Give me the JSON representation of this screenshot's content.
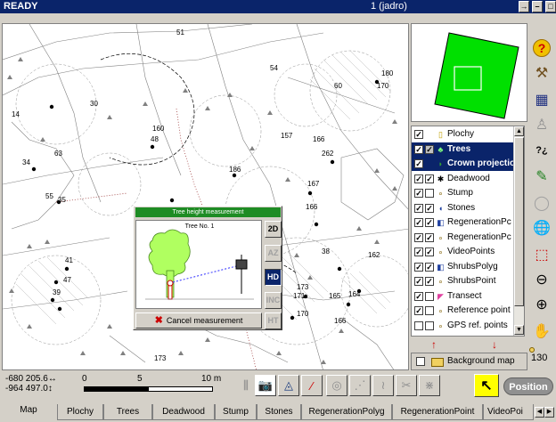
{
  "titlebar": {
    "status": "READY",
    "mode": "1 (jadro)"
  },
  "dialog": {
    "header": "Tree height measurement",
    "tree_label": "Tree No. 1",
    "side_buttons": [
      "2D",
      "AZ",
      "HD",
      "INC",
      "HT"
    ],
    "active_button": "HD",
    "cancel_label": "Cancel measurement"
  },
  "map_labels": {
    "plot_numbers": [
      "51",
      "180",
      "170",
      "60",
      "54",
      "14",
      "160",
      "30",
      "48",
      "157",
      "166",
      "186",
      "63",
      "55",
      "262",
      "167",
      "34",
      "35",
      "166",
      "162",
      "38",
      "47",
      "39",
      "41",
      "173",
      "171",
      "168",
      "170",
      "164",
      "165",
      "166",
      "173"
    ]
  },
  "layers": {
    "items": [
      {
        "label": "Plochy",
        "check1": true,
        "check2": null,
        "icon": "yellow-square-icon",
        "selected": false
      },
      {
        "label": "Trees",
        "check1": true,
        "check2": true,
        "icon": "tree-icon",
        "selected": true
      },
      {
        "label": "Crown projection",
        "check1": true,
        "check2": null,
        "icon": "crown-icon",
        "selected": true
      },
      {
        "label": "Deadwood",
        "check1": true,
        "check2": true,
        "icon": "deadwood-icon",
        "selected": false
      },
      {
        "label": "Stump",
        "check1": true,
        "check2": false,
        "icon": "point-icon",
        "selected": false
      },
      {
        "label": "Stones",
        "check1": true,
        "check2": true,
        "icon": "stone-icon",
        "selected": false
      },
      {
        "label": "RegenerationPc",
        "check1": true,
        "check2": true,
        "icon": "polygon-icon",
        "selected": false
      },
      {
        "label": "RegenerationPc",
        "check1": true,
        "check2": true,
        "icon": "point-icon",
        "selected": false
      },
      {
        "label": "VideoPoints",
        "check1": true,
        "check2": true,
        "icon": "point-icon",
        "selected": false
      },
      {
        "label": "ShrubsPolyg",
        "check1": true,
        "check2": true,
        "icon": "polygon-icon",
        "selected": false
      },
      {
        "label": "ShrubsPoint",
        "check1": true,
        "check2": true,
        "icon": "point-icon",
        "selected": false
      },
      {
        "label": "Transect",
        "check1": true,
        "check2": false,
        "icon": "transect-icon",
        "selected": false
      },
      {
        "label": "Reference point",
        "check1": true,
        "check2": false,
        "icon": "point-icon",
        "selected": false
      },
      {
        "label": "GPS ref. points",
        "check1": false,
        "check2": false,
        "icon": "point-icon",
        "selected": false
      }
    ],
    "background_map_label": "Background map"
  },
  "status": {
    "coord_x": "-680 205.6",
    "coord_y": "-964 497.0",
    "scale_labels": [
      "0",
      "5",
      "10 m"
    ],
    "zoom": "130",
    "position_button": "Position"
  },
  "tabs": [
    "Map",
    "Plochy",
    "Trees",
    "Deadwood",
    "Stump",
    "Stones",
    "RegenerationPolyg",
    "RegenerationPoint",
    "VideoPoi"
  ],
  "colors": {
    "titlebar": "#0a246a",
    "dialog_header": "#1e8c24",
    "overview_fill": "#00e000",
    "tree_crown": "#b0ff60"
  }
}
